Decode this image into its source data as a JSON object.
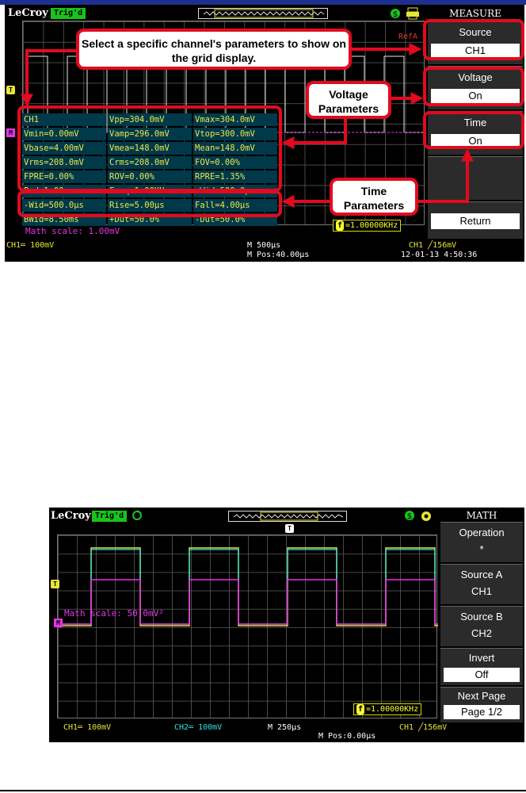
{
  "screen1": {
    "logo": "LeCroy",
    "trigger_status": "Trig'd",
    "menu_title": "MEASURE",
    "softkeys": [
      {
        "label": "Source",
        "value": "CH1"
      },
      {
        "label": "Voltage",
        "value": "On"
      },
      {
        "label": "Time",
        "value": "On"
      },
      {
        "label": "",
        "value": ""
      },
      {
        "label": "",
        "value": "Return"
      }
    ],
    "ref_label": "RefA",
    "params": [
      [
        "CH1",
        "Vpp=304.0mV",
        "Vmax=304.0mV"
      ],
      [
        "Vmin=0.00mV",
        "Vamp=296.0mV",
        "Vtop=300.0mV"
      ],
      [
        "Vbase=4.00mV",
        "Vmea=148.0mV",
        "Mean=148.0mV"
      ],
      [
        "Vrms=208.0mV",
        "Crms=208.0mV",
        "FOV=0.00%"
      ],
      [
        "FPRE=0.00%",
        "ROV=0.00%",
        "RPRE=1.35%"
      ],
      [
        "Prd=1.00ms",
        "Freq=1.00KHz",
        "+Wid=500.0μs"
      ],
      [
        "-Wid=500.0μs",
        "Rise=5.00μs",
        "Fall=4.00μs"
      ],
      [
        "BWid=8.50ms",
        "+Dut=50.0%",
        "-Dut=50.0%"
      ]
    ],
    "math_scale": "Math scale: 1.00mV",
    "freq_readout": "=1.00000KHz",
    "ch1_scale": "CH1═ 100mV",
    "timebase": "M 500μs",
    "mpos": "M Pos:40.00μs",
    "trigger_info": "CH1 ╱156mV",
    "datetime": "12-01-13 4:50:36",
    "callouts": {
      "source_note": "Select a specific channel's parameters to show on the grid display.",
      "voltage_note": "Voltage Parameters",
      "time_note": "Time Parameters"
    }
  },
  "screen2": {
    "logo": "LeCroy",
    "trigger_status": "Trig'd",
    "menu_title": "MATH",
    "softkeys": [
      {
        "label": "Operation",
        "value": "*"
      },
      {
        "label": "Source A",
        "value": "CH1"
      },
      {
        "label": "Source B",
        "value": "CH2"
      },
      {
        "label": "Invert",
        "value": "Off"
      },
      {
        "label": "Next Page",
        "value": "Page 1/2"
      }
    ],
    "math_scale": "Math scale: 50.0mV²",
    "freq_readout": "=1.00000KHz",
    "ch1_scale": "CH1═ 100mV",
    "ch2_scale": "CH2═ 100mV",
    "timebase": "M 250μs",
    "mpos": "M Pos:0.00μs",
    "trigger_info": "CH1 ╱156mV"
  },
  "colors": {
    "callout_red": "#e30a1e",
    "ch1_yellow": "#e6e63a",
    "ch2_cyan": "#2ee6e6",
    "math_magenta": "#e633e6",
    "trig_green": "#19c419"
  }
}
